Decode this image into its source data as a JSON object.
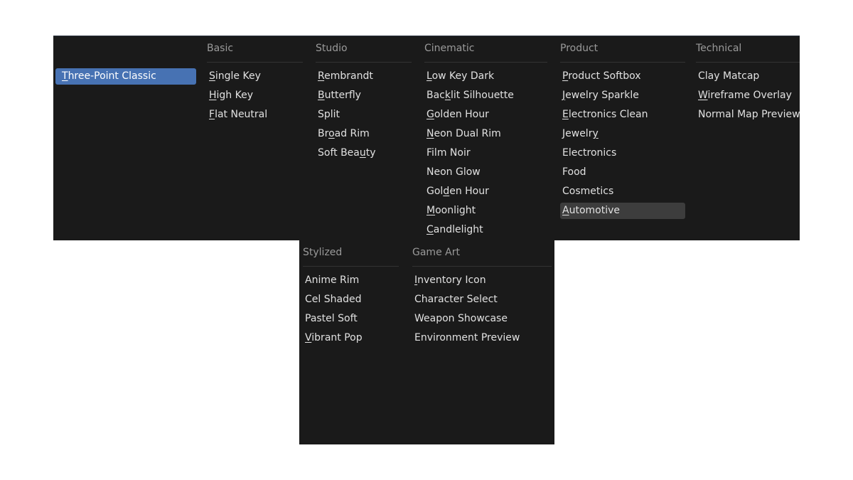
{
  "colors": {
    "panel_bg": "#1a1a1a",
    "selected_bg": "#4772b3",
    "hover_bg": "#3d3d3d",
    "header_text": "#9a9a9a",
    "item_text": "#e1e1e1"
  },
  "main_panel": {
    "columns": [
      {
        "id": "current",
        "header": "",
        "items": [
          {
            "label": "Three-Point Classic",
            "ul": 0,
            "state": "active"
          }
        ]
      },
      {
        "id": "basic",
        "header": "Basic",
        "items": [
          {
            "label": "Single Key",
            "ul": 0
          },
          {
            "label": "High Key",
            "ul": 0
          },
          {
            "label": "Flat Neutral",
            "ul": 0
          }
        ]
      },
      {
        "id": "studio",
        "header": "Studio",
        "items": [
          {
            "label": "Rembrandt",
            "ul": 0
          },
          {
            "label": "Butterfly",
            "ul": 0
          },
          {
            "label": "Split"
          },
          {
            "label": "Broad Rim",
            "ul": 2
          },
          {
            "label": "Soft Beauty",
            "ul": 8
          }
        ]
      },
      {
        "id": "cinematic",
        "header": "Cinematic",
        "items": [
          {
            "label": "Low Key Dark",
            "ul": 0
          },
          {
            "label": "Backlit Silhouette",
            "ul": 3
          },
          {
            "label": "Golden Hour",
            "ul": 0
          },
          {
            "label": "Neon Dual Rim",
            "ul": 0
          },
          {
            "label": "Film Noir"
          },
          {
            "label": "Neon Glow"
          },
          {
            "label": "Golden Hour",
            "ul": 3
          },
          {
            "label": "Moonlight",
            "ul": 0
          },
          {
            "label": "Candlelight",
            "ul": 0
          }
        ]
      },
      {
        "id": "product",
        "header": "Product",
        "items": [
          {
            "label": "Product Softbox",
            "ul": 0
          },
          {
            "label": "Jewelry Sparkle",
            "ul": 0
          },
          {
            "label": "Electronics Clean",
            "ul": 0
          },
          {
            "label": "Jewelry",
            "ul": 6
          },
          {
            "label": "Electronics"
          },
          {
            "label": "Food"
          },
          {
            "label": "Cosmetics"
          },
          {
            "label": "Automotive",
            "ul": 0,
            "state": "hover"
          }
        ]
      },
      {
        "id": "technical",
        "header": "Technical",
        "items": [
          {
            "label": "Clay Matcap"
          },
          {
            "label": "Wireframe Overlay",
            "ul": 0
          },
          {
            "label": "Normal Map Preview"
          }
        ]
      }
    ]
  },
  "sub_panel": {
    "columns": [
      {
        "id": "stylized",
        "header": "Stylized",
        "items": [
          {
            "label": "Anime Rim"
          },
          {
            "label": "Cel Shaded"
          },
          {
            "label": "Pastel Soft"
          },
          {
            "label": "Vibrant Pop",
            "ul": 0
          }
        ]
      },
      {
        "id": "game-art",
        "header": "Game Art",
        "items": [
          {
            "label": "Inventory Icon",
            "ul": 0
          },
          {
            "label": "Character Select"
          },
          {
            "label": "Weapon Showcase"
          },
          {
            "label": "Environment Preview"
          }
        ]
      }
    ]
  }
}
